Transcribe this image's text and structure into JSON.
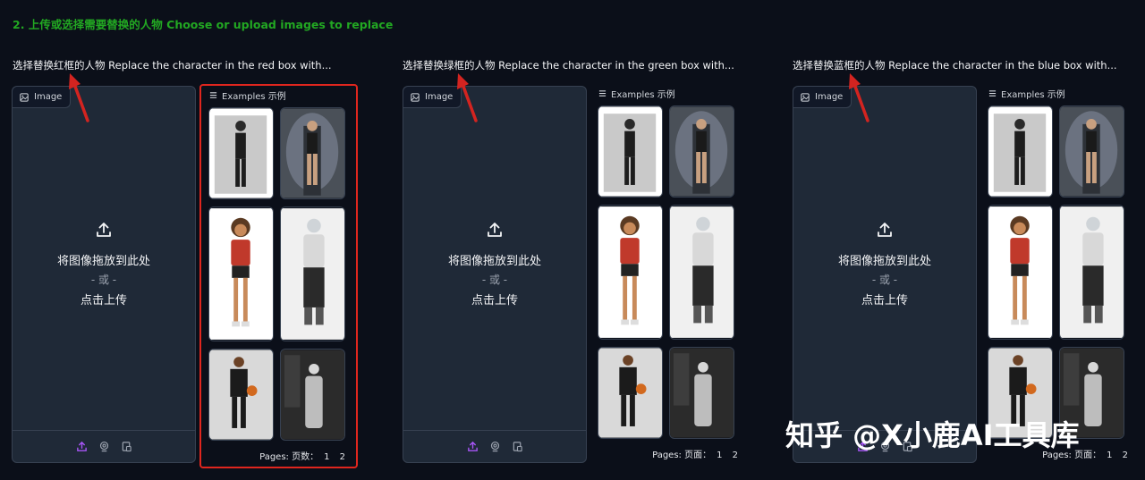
{
  "section_heading": "2. 上传或选择需要替换的人物 Choose or upload images to replace",
  "colors": {
    "heading_green": "#22a822",
    "highlight_red": "#e0261e",
    "arrow_red": "#d32420",
    "background": "#0b0f19",
    "panel": "#1f2937",
    "upload_icon_purple": "#a855f7"
  },
  "panels": [
    {
      "subtitle": "选择替换红框的人物 Replace the character in the red box with...",
      "image_tag": "Image",
      "drop_text": "将图像拖放到此处",
      "or_text": "- 或 -",
      "click_text": "点击上传",
      "examples_label": "Examples  示例",
      "pages_label": "Pages:   页数：",
      "pages_numbers": "1 2"
    },
    {
      "subtitle": "选择替换绿框的人物 Replace the character in the green box with...",
      "image_tag": "Image",
      "drop_text": "将图像拖放到此处",
      "or_text": "- 或 -",
      "click_text": "点击上传",
      "examples_label": "Examples  示例",
      "pages_label": "Pages:   页面：",
      "pages_numbers": "1 2"
    },
    {
      "subtitle": "选择替换蓝框的人物 Replace the character in the blue box with...",
      "image_tag": "Image",
      "drop_text": "将图像拖放到此处",
      "or_text": "- 或 -",
      "click_text": "点击上传",
      "examples_label": "Examples  示例",
      "pages_label": "Pages:   页面：",
      "pages_numbers": "1 2"
    }
  ],
  "icons": {
    "source_icons": [
      "upload-icon",
      "webcam-icon",
      "clipboard-icon"
    ],
    "tag_icon": "image-icon",
    "examples_icon": "list-icon"
  },
  "watermark": "知乎 @X小鹿AI工具库"
}
